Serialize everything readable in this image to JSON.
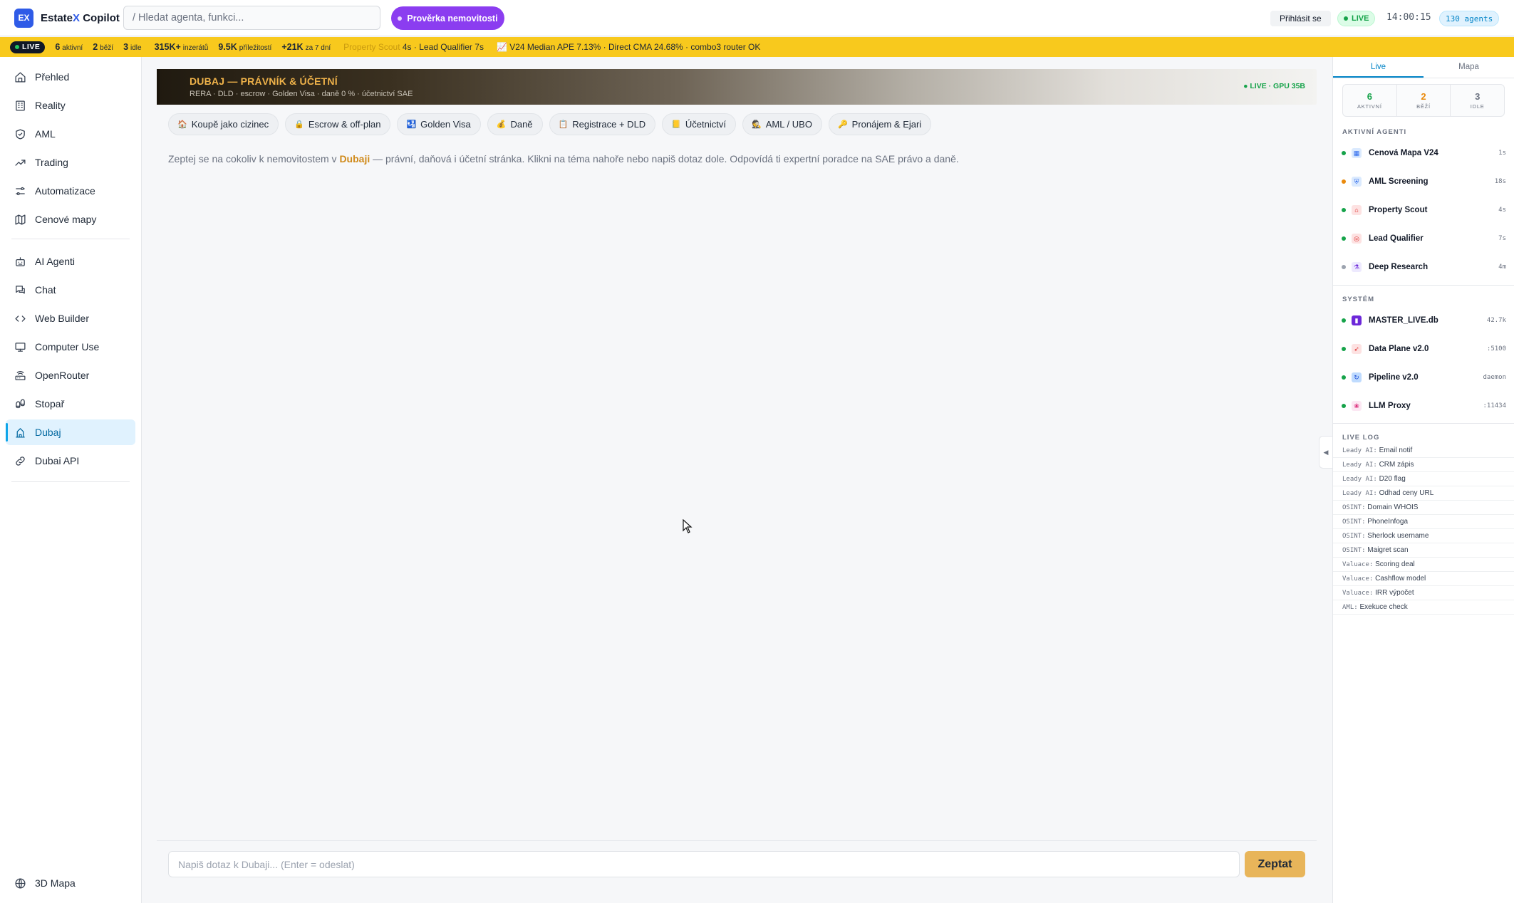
{
  "app": {
    "logo": "EX",
    "brand_pre": "Estate",
    "brand_x": "X",
    "brand_post": " Copilot"
  },
  "search": {
    "placeholder": "/ Hledat agenta, funkci..."
  },
  "header": {
    "check_button": "Prověrka nemovitosti",
    "login_button": "Přihlásit se",
    "live": "LIVE",
    "clock": "14:00:15",
    "agents_count": "130 agents"
  },
  "ticker": {
    "live": "LIVE",
    "active_n": "6",
    "active_l": "aktivní",
    "running_n": "2",
    "running_l": "běží",
    "idle_n": "3",
    "idle_l": "idle",
    "listings_n": "315K+",
    "listings_l": "inzerátů",
    "opps_n": "9.5K",
    "opps_l": "příležitostí",
    "week_n": "+21K",
    "week_l": "za 7 dní",
    "msg1_fade": "Property Scout",
    "msg1": " 4s · Lead Qualifier 7s",
    "msg2": "📈 V24 Median APE 7.13% · Direct CMA 24.68% · combo3 router OK"
  },
  "sidebar": {
    "items": [
      {
        "label": "Přehled",
        "icon": "home-icon"
      },
      {
        "label": "Reality",
        "icon": "building-icon"
      },
      {
        "label": "AML",
        "icon": "shield-icon"
      },
      {
        "label": "Trading",
        "icon": "trend-icon"
      },
      {
        "label": "Automatizace",
        "icon": "sliders-icon"
      },
      {
        "label": "Cenové mapy",
        "icon": "map-icon"
      },
      {
        "label": "AI Agenti",
        "icon": "bot-icon"
      },
      {
        "label": "Chat",
        "icon": "chat-icon"
      },
      {
        "label": "Web Builder",
        "icon": "code-icon"
      },
      {
        "label": "Computer Use",
        "icon": "monitor-icon"
      },
      {
        "label": "OpenRouter",
        "icon": "router-icon"
      },
      {
        "label": "Stopař",
        "icon": "footprint-icon"
      },
      {
        "label": "Dubaj",
        "icon": "landmark-icon"
      },
      {
        "label": "Dubai API",
        "icon": "link-icon"
      }
    ],
    "bottom": {
      "label": "3D Mapa",
      "icon": "globe-icon"
    }
  },
  "main": {
    "banner_title": "DUBAJ — PRÁVNÍK & ÚČETNÍ",
    "banner_sub": "RERA · DLD · escrow · Golden Visa · daně 0 % · účetnictví SAE",
    "banner_status": "● LIVE · GPU 35B",
    "chips": [
      {
        "icon": "🏠",
        "label": "Koupě jako cizinec"
      },
      {
        "icon": "🔒",
        "label": "Escrow & off-plan"
      },
      {
        "icon": "🛂",
        "label": "Golden Visa"
      },
      {
        "icon": "💰",
        "label": "Daně"
      },
      {
        "icon": "📋",
        "label": "Registrace + DLD"
      },
      {
        "icon": "📒",
        "label": "Účetnictví"
      },
      {
        "icon": "🕵",
        "label": "AML / UBO"
      },
      {
        "icon": "🔑",
        "label": "Pronájem & Ejari"
      }
    ],
    "intro_pre": "Zeptej se na cokoliv k nemovitostem v ",
    "intro_hl": "Dubaji",
    "intro_post": " — právní, daňová i účetní stránka. Klikni na téma nahoře nebo napiš dotaz dole. Odpovídá ti expertní poradce na SAE právo a daně.",
    "input_placeholder": "Napiš dotaz k Dubaji... (Enter = odeslat)",
    "ask_button": "Zeptat"
  },
  "rpanel": {
    "tabs": [
      "Live",
      "Mapa"
    ],
    "stats": [
      {
        "n": "6",
        "t": "AKTIVNÍ",
        "color": "#16a34a"
      },
      {
        "n": "2",
        "t": "BĚŽÍ",
        "color": "#ea8a0c"
      },
      {
        "n": "3",
        "t": "IDLE",
        "color": "#6b7280"
      }
    ],
    "agents_title": "AKTIVNÍ AGENTI",
    "agents": [
      {
        "name": "Cenová Mapa V24",
        "val": "1s",
        "dot": "#16a34a",
        "icon": "▦"
      },
      {
        "name": "AML Screening",
        "val": "18s",
        "dot": "#ea8a0c",
        "icon": "⛨"
      },
      {
        "name": "Property Scout",
        "val": "4s",
        "dot": "#16a34a",
        "icon": "⌂"
      },
      {
        "name": "Lead Qualifier",
        "val": "7s",
        "dot": "#16a34a",
        "icon": "◎"
      },
      {
        "name": "Deep Research",
        "val": "4m",
        "dot": "#9ca3af",
        "icon": "⚗"
      }
    ],
    "system_title": "SYSTÉM",
    "system": [
      {
        "name": "MASTER_LIVE.db",
        "val": "42.7k",
        "icon": "▮"
      },
      {
        "name": "Data Plane v2.0",
        "val": ":5100",
        "icon": "➶"
      },
      {
        "name": "Pipeline v2.0",
        "val": "daemon",
        "icon": "↻"
      },
      {
        "name": "LLM Proxy",
        "val": ":11434",
        "icon": "❀"
      }
    ],
    "log_title": "LIVE LOG",
    "log": [
      {
        "src": "Leady AI:",
        "msg": "Email notif"
      },
      {
        "src": "Leady AI:",
        "msg": "CRM zápis"
      },
      {
        "src": "Leady AI:",
        "msg": "D20 flag"
      },
      {
        "src": "Leady AI:",
        "msg": "Odhad ceny URL"
      },
      {
        "src": "OSINT:",
        "msg": "Domain WHOIS"
      },
      {
        "src": "OSINT:",
        "msg": "PhoneInfoga"
      },
      {
        "src": "OSINT:",
        "msg": "Sherlock username"
      },
      {
        "src": "OSINT:",
        "msg": "Maigret scan"
      },
      {
        "src": "Valuace:",
        "msg": "Scoring deal"
      },
      {
        "src": "Valuace:",
        "msg": "Cashflow model"
      },
      {
        "src": "Valuace:",
        "msg": "IRR výpočet"
      },
      {
        "src": "AML:",
        "msg": "Exekuce check"
      }
    ]
  }
}
